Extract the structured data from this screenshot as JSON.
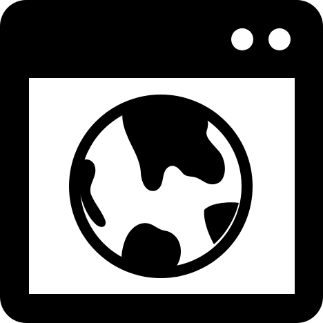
{
  "icon": {
    "name": "browser-window-globe-icon",
    "foreground_color": "#000000",
    "background_color": "#ffffff",
    "window": {
      "title_bar_dots": 2
    },
    "content": {
      "globe_icon": "globe-icon"
    }
  }
}
